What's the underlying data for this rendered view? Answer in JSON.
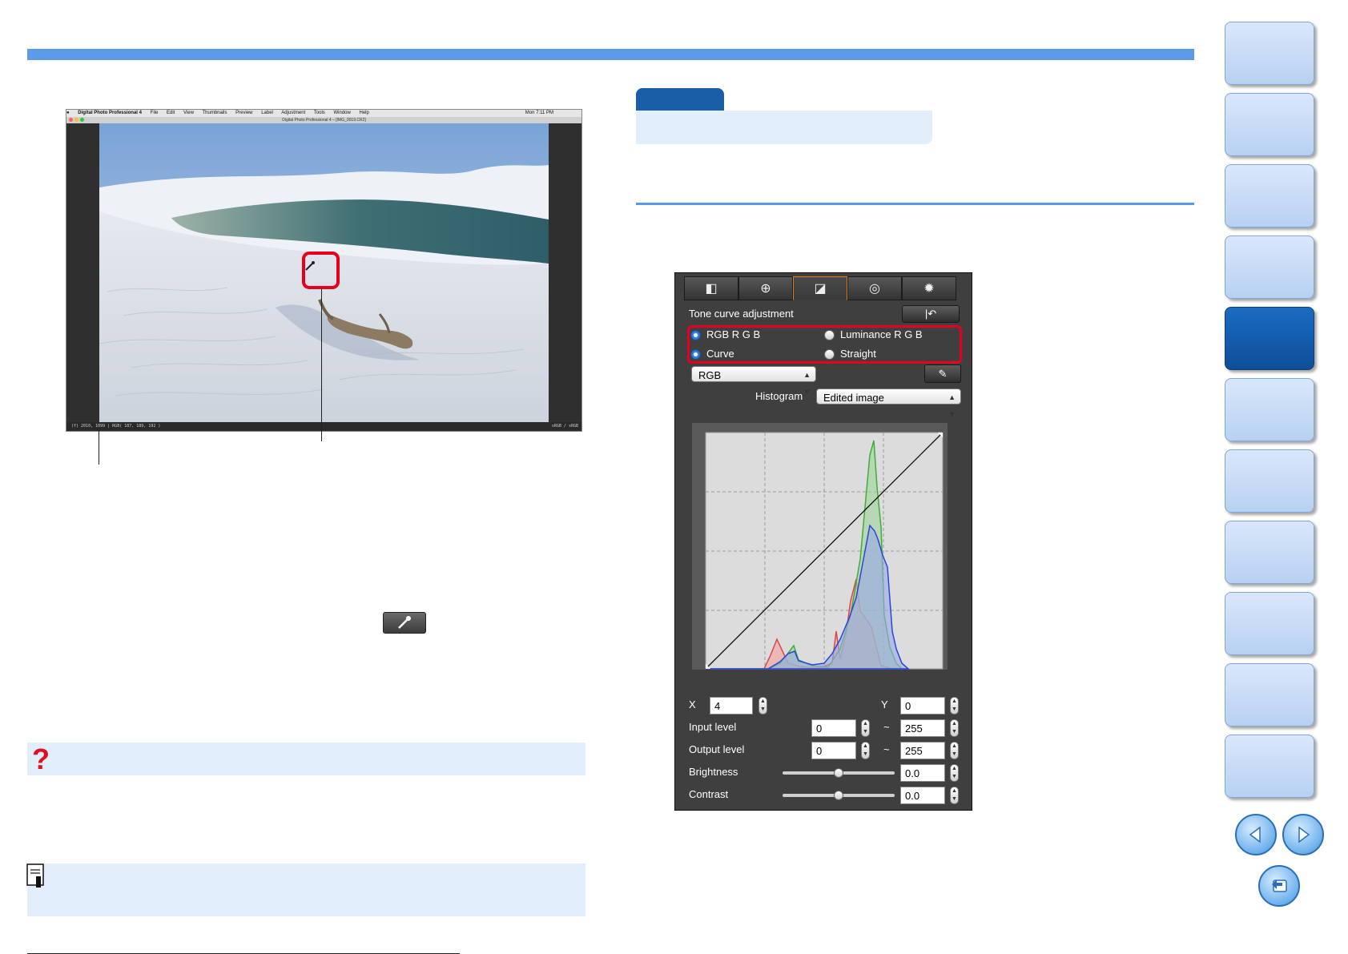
{
  "app_screenshot": {
    "menu_items": [
      "Digital Photo Professional 4",
      "File",
      "Edit",
      "View",
      "Thumbnails",
      "Preview",
      "Label",
      "Adjustment",
      "Tools",
      "Window",
      "Help"
    ],
    "clock": "Mon 7:11 PM",
    "window_title": "Digital Photo Professional 4 – [IMG_0019.CR2]",
    "status_left": "(Y) 2010, 1099 | RGB( 187, 189, 192 )",
    "status_right": "sRGB / sRGB"
  },
  "palette": {
    "tab_icons": [
      "basic-image-icon",
      "detail-zoom-icon",
      "tone-curve-icon",
      "color-icon",
      "settings-gear-icon"
    ],
    "tab_glyphs": [
      "◧",
      "⊕",
      "◪",
      "◎",
      "✹"
    ],
    "title": "Tone curve adjustment",
    "reset_glyph": "|↶",
    "radio_rgb": "RGB R G B",
    "radio_luminance": "Luminance R G B",
    "radio_curve": "Curve",
    "radio_straight": "Straight",
    "channel_select": "RGB",
    "eyedropper_glyph": "✎",
    "histogram_label": "Histogram",
    "histogram_select": "Edited image",
    "x_label": "X",
    "x_value": "4",
    "y_label": "Y",
    "y_value": "0",
    "input_level_label": "Input level",
    "input_level_min": "0",
    "input_level_max": "255",
    "output_level_label": "Output level",
    "output_level_min": "0",
    "output_level_max": "255",
    "range_sep": "~",
    "brightness_label": "Brightness",
    "brightness_value": "0.0",
    "contrast_label": "Contrast",
    "contrast_value": "0.0",
    "brightness_level": 0.5,
    "contrast_level": 0.5
  },
  "side_nav": {
    "active_index": 4,
    "count": 11
  },
  "faq_icon": "?",
  "colors": {
    "accent_blue": "#5b9be8",
    "highlight_red": "#e6001e",
    "dark_blue": "#1a5ea8",
    "panel_light": "#e2eefb"
  }
}
